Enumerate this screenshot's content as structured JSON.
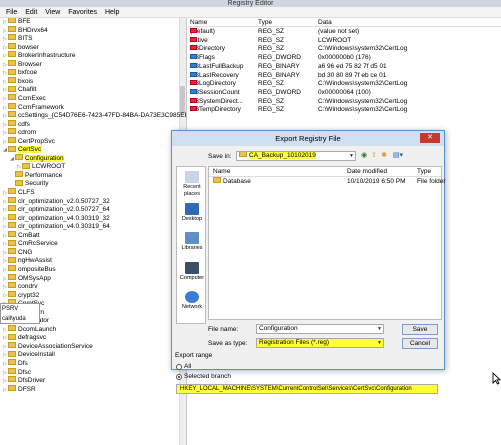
{
  "window": {
    "title": "Registry Editor"
  },
  "menu": [
    "File",
    "Edit",
    "View",
    "Favorites",
    "Help"
  ],
  "tree": [
    {
      "label": "BFE",
      "indent": 0,
      "expand": "▷"
    },
    {
      "label": "BHDrvx64",
      "indent": 0,
      "expand": "▷"
    },
    {
      "label": "BITS",
      "indent": 0,
      "expand": "▷"
    },
    {
      "label": "bowser",
      "indent": 0,
      "expand": "▷"
    },
    {
      "label": "BrokerInfrastructure",
      "indent": 0,
      "expand": "▷"
    },
    {
      "label": "Browser",
      "indent": 0,
      "expand": "▷"
    },
    {
      "label": "bxfcoe",
      "indent": 0,
      "expand": "▷"
    },
    {
      "label": "bxois",
      "indent": 0,
      "expand": "▷"
    },
    {
      "label": "Cbafilt",
      "indent": 0,
      "expand": "▷"
    },
    {
      "label": "CcmExec",
      "indent": 0,
      "expand": "▷"
    },
    {
      "label": "CcmFramework",
      "indent": 0,
      "expand": "▷"
    },
    {
      "label": "ccSettings_{C54D76E6-7423-47FD-84BA-DA73E3C985EE}",
      "indent": 0,
      "expand": "▷"
    },
    {
      "label": "cdfs",
      "indent": 0,
      "expand": "▷"
    },
    {
      "label": "cdrom",
      "indent": 0,
      "expand": "▷"
    },
    {
      "label": "CertPropSvc",
      "indent": 0,
      "expand": "▷"
    },
    {
      "label": "CertSvc",
      "indent": 0,
      "expand": "◢",
      "hl": true
    },
    {
      "label": "Configuration",
      "indent": 1,
      "expand": "◢",
      "hl": true
    },
    {
      "label": "LCWROOT",
      "indent": 2,
      "expand": "▷"
    },
    {
      "label": "Performance",
      "indent": 1,
      "expand": ""
    },
    {
      "label": "Security",
      "indent": 1,
      "expand": ""
    },
    {
      "label": "CLFS",
      "indent": 0,
      "expand": "▷"
    },
    {
      "label": "clr_optimization_v2.0.50727_32",
      "indent": 0,
      "expand": "▷"
    },
    {
      "label": "clr_optimization_v2.0.50727_64",
      "indent": 0,
      "expand": "▷"
    },
    {
      "label": "clr_optimization_v4.0.30319_32",
      "indent": 0,
      "expand": "▷"
    },
    {
      "label": "clr_optimization_v4.0.30319_64",
      "indent": 0,
      "expand": "▷"
    },
    {
      "label": "CmBatt",
      "indent": 0,
      "expand": "▷"
    },
    {
      "label": "CmRcService",
      "indent": 0,
      "expand": "▷"
    },
    {
      "label": "CNG",
      "indent": 0,
      "expand": "▷"
    },
    {
      "label": "ngHwAssist",
      "indent": 0,
      "expand": "▷"
    },
    {
      "label": "ompositeBus",
      "indent": 0,
      "expand": "▷"
    },
    {
      "label": "OMSysApp",
      "indent": 0,
      "expand": "▷"
    },
    {
      "label": "condrv",
      "indent": 0,
      "expand": "▷"
    },
    {
      "label": "crypt32",
      "indent": 0,
      "expand": "▷"
    },
    {
      "label": "CryptSvc",
      "indent": 0,
      "expand": "▷"
    },
    {
      "label": "Datascrn",
      "indent": 0,
      "expand": "▷"
    },
    {
      "label": "DCLocator",
      "indent": 0,
      "expand": "▷"
    },
    {
      "label": "DcomLaunch",
      "indent": 0,
      "expand": "▷"
    },
    {
      "label": "defragsvc",
      "indent": 0,
      "expand": "▷"
    },
    {
      "label": "DeviceAssociationService",
      "indent": 0,
      "expand": "▷"
    },
    {
      "label": "DeviceInstall",
      "indent": 0,
      "expand": "▷"
    },
    {
      "label": "Dfs",
      "indent": 0,
      "expand": "▷"
    },
    {
      "label": "Dfsc",
      "indent": 0,
      "expand": "▷"
    },
    {
      "label": "DfsDriver",
      "indent": 0,
      "expand": "▷"
    },
    {
      "label": "DFSR",
      "indent": 0,
      "expand": "▷"
    }
  ],
  "tooltip": [
    "PSRV",
    "call\\yuda"
  ],
  "values": {
    "headers": {
      "name": "Name",
      "type": "Type",
      "data": "Data"
    },
    "rows": [
      {
        "name": "(Default)",
        "type": "REG_SZ",
        "data": "(value not set)",
        "icon": "ab"
      },
      {
        "name": "Active",
        "type": "REG_SZ",
        "data": "LCWROOT",
        "icon": "ab"
      },
      {
        "name": "DBDirectory",
        "type": "REG_SZ",
        "data": "C:\\Windows\\system32\\CertLog",
        "icon": "ab"
      },
      {
        "name": "DBFlags",
        "type": "REG_DWORD",
        "data": "0x000000b0 (176)",
        "icon": "bin"
      },
      {
        "name": "DBLastFullBackup",
        "type": "REG_BINARY",
        "data": "a6 96 ed 75 82 7f d5 01",
        "icon": "bin"
      },
      {
        "name": "DBLastRecovery",
        "type": "REG_BINARY",
        "data": "bd 30 80 89 7f eb ce 01",
        "icon": "bin"
      },
      {
        "name": "DBLogDirectory",
        "type": "REG_SZ",
        "data": "C:\\Windows\\system32\\CertLog",
        "icon": "ab"
      },
      {
        "name": "DBSessionCount",
        "type": "REG_DWORD",
        "data": "0x00000064 (100)",
        "icon": "bin"
      },
      {
        "name": "DBSystemDirect...",
        "type": "REG_SZ",
        "data": "C:\\Windows\\system32\\CertLog",
        "icon": "ab"
      },
      {
        "name": "DBTempDirectory",
        "type": "REG_SZ",
        "data": "C:\\Windows\\system32\\CertLog",
        "icon": "ab"
      }
    ]
  },
  "dialog": {
    "title": "Export Registry File",
    "close": "✕",
    "save_in_label": "Save in:",
    "save_in_value": "CA_Backup_10102019",
    "places": [
      "Recent places",
      "Desktop",
      "Libraries",
      "Computer",
      "Network"
    ],
    "file_headers": {
      "name": "Name",
      "date": "Date modified",
      "type": "Type"
    },
    "files": [
      {
        "name": "Database",
        "date": "10/10/2019 6:50 PM",
        "type": "File folder"
      }
    ],
    "file_name_label": "File name:",
    "file_name_value": "Configuration",
    "save_as_label": "Save as type:",
    "save_as_value": "Registration Files (*.reg)",
    "save_button": "Save",
    "cancel_button": "Cancel",
    "export_range_label": "Export range",
    "all_label": "All",
    "selected_label": "Selected branch",
    "branch_path": "HKEY_LOCAL_MACHINE\\SYSTEM\\CurrentControlSet\\Services\\CertSvc\\Configuration"
  },
  "colors": {
    "highlight": "#ffff3a",
    "title_bar": "#cfe0f3"
  }
}
